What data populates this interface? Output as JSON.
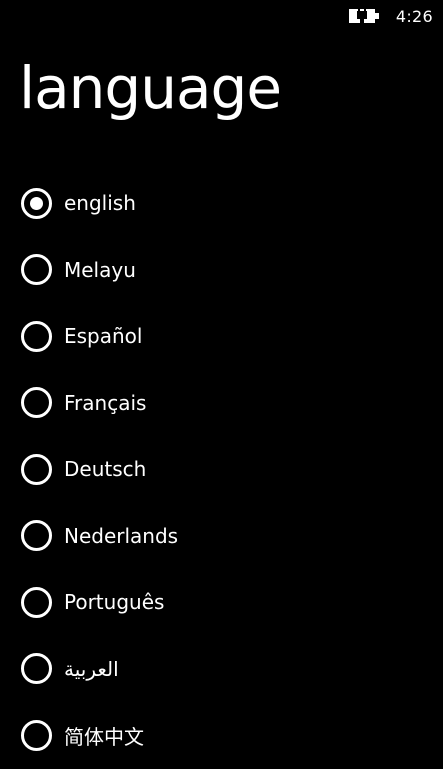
{
  "status_bar": {
    "battery_icon": "battery-charging-icon",
    "time": "4:26"
  },
  "page": {
    "title": "language"
  },
  "languages": {
    "selected_index": 0,
    "items": [
      {
        "label": "english",
        "checked": true
      },
      {
        "label": "Melayu",
        "checked": false
      },
      {
        "label": "Español",
        "checked": false
      },
      {
        "label": "Français",
        "checked": false
      },
      {
        "label": "Deutsch",
        "checked": false
      },
      {
        "label": "Nederlands",
        "checked": false
      },
      {
        "label": "Português",
        "checked": false
      },
      {
        "label": "العربية",
        "checked": false
      },
      {
        "label": "简体中文",
        "checked": false
      }
    ]
  },
  "colors": {
    "background": "#000000",
    "foreground": "#ffffff"
  }
}
